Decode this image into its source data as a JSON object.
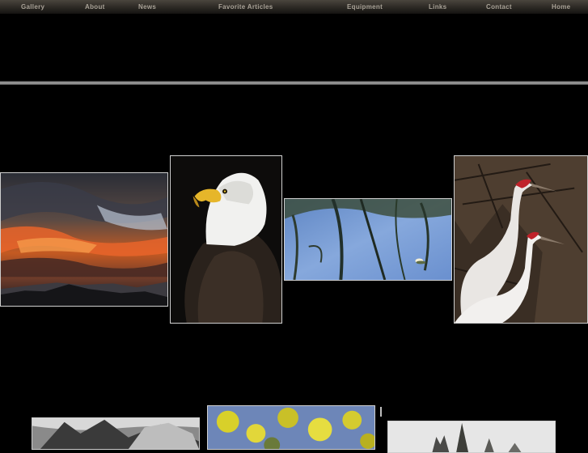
{
  "nav": {
    "items": [
      {
        "label": "Gallery"
      },
      {
        "label": "About"
      },
      {
        "label": "News"
      },
      {
        "label": "Favorite Articles"
      },
      {
        "label": "Equipment"
      },
      {
        "label": "Links"
      },
      {
        "label": "Contact"
      },
      {
        "label": "Home"
      }
    ]
  },
  "colors": {
    "background": "#000000",
    "nav_text": "#a9a297",
    "nav_bar": "#2e2b26",
    "photo_border": "#cfcfcf"
  },
  "gallery": {
    "photos": [
      {
        "subject": "sunset-over-mountains"
      },
      {
        "subject": "bald-eagle"
      },
      {
        "subject": "water-reflection"
      },
      {
        "subject": "sandhill-cranes"
      },
      {
        "subject": "black-and-white-landscape"
      },
      {
        "subject": "yellow-foliage"
      },
      {
        "subject": "snowy-trees"
      }
    ]
  }
}
